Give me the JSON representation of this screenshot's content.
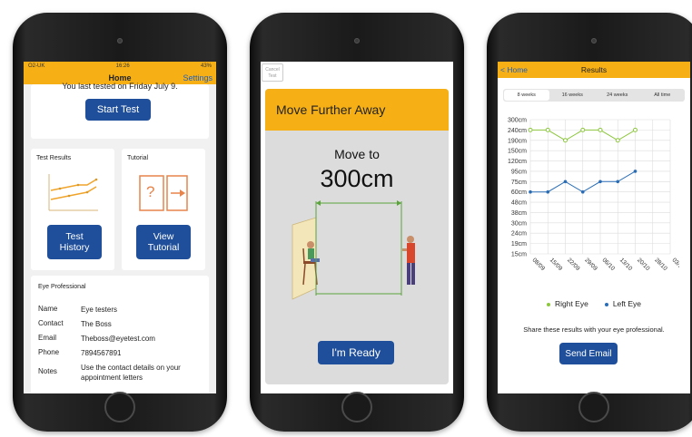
{
  "phone1": {
    "status": {
      "carrier": "O2-UK",
      "time": "16:26",
      "battery": "43%"
    },
    "nav": {
      "title": "Home",
      "settings": "Settings"
    },
    "last_tested": "You last tested on Friday July 9.",
    "start_button": "Start Test",
    "results_card": {
      "title": "Test Results",
      "button": "Test\nHistory"
    },
    "tutorial_card": {
      "title": "Tutorial",
      "button": "View\nTutorial",
      "icon_glyph": "?"
    },
    "professional": {
      "title": "Eye Professional",
      "rows": [
        {
          "label": "Name",
          "value": "Eye testers"
        },
        {
          "label": "Contact",
          "value": "The Boss"
        },
        {
          "label": "Email",
          "value": "Theboss@eyetest.com"
        },
        {
          "label": "Phone",
          "value": "7894567891"
        },
        {
          "label": "Notes",
          "value": "Use the contact details on your appointment letters"
        }
      ]
    }
  },
  "phone2": {
    "cancel": "Cancel\nTest",
    "banner": "Move Further Away",
    "move_to": "Move to",
    "distance": "300cm",
    "ready_button": "I'm Ready"
  },
  "phone3": {
    "nav": {
      "back": "< Home",
      "title": "Results"
    },
    "tabs": [
      {
        "label": "8 weeks",
        "active": true
      },
      {
        "label": "16 weeks",
        "active": false
      },
      {
        "label": "24 weeks",
        "active": false
      },
      {
        "label": "All time",
        "active": false
      }
    ],
    "legend": [
      {
        "name": "Right Eye",
        "color": "#8dc63f"
      },
      {
        "name": "Left Eye",
        "color": "#2a6db5"
      }
    ],
    "share_text": "Share these results with your eye professional.",
    "email_button": "Send Email"
  },
  "chart_data": {
    "type": "line",
    "y_categories": [
      "300cm",
      "240cm",
      "190cm",
      "150cm",
      "120cm",
      "95cm",
      "75cm",
      "60cm",
      "48cm",
      "38cm",
      "30cm",
      "24cm",
      "19cm",
      "15cm"
    ],
    "x": [
      "08/09",
      "15/09",
      "22/09",
      "29/09",
      "06/10",
      "13/10",
      "20/10",
      "28/10",
      "03/11"
    ],
    "series": [
      {
        "name": "Right Eye",
        "values": [
          "240cm",
          "240cm",
          "190cm",
          "240cm",
          "240cm",
          "190cm",
          "240cm"
        ]
      },
      {
        "name": "Left Eye",
        "values": [
          "60cm",
          "60cm",
          "75cm",
          "60cm",
          "75cm",
          "75cm",
          "95cm"
        ]
      }
    ],
    "grid": true,
    "legend_position": "bottom"
  },
  "colors": {
    "accent": "#f6b016",
    "button": "#1f4f9a",
    "link": "#1f5fbf"
  }
}
